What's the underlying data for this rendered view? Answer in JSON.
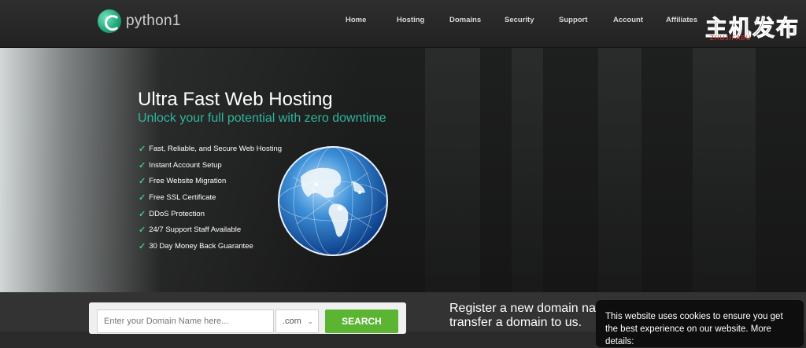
{
  "header": {
    "logo_text": "python1",
    "nav": [
      "Home",
      "Hosting",
      "Domains",
      "Security",
      "Support",
      "Account",
      "Affiliates"
    ],
    "watermark": {
      "main": "主机发布",
      "sub": "ZHUJIFABU"
    }
  },
  "hero": {
    "title": "Ultra Fast Web Hosting",
    "subtitle": "Unlock your full potential with zero downtime",
    "features": [
      "Fast, Reliable, and Secure Web Hosting",
      "Instant Account Setup",
      "Free Website Migration",
      "Free SSL Certificate",
      "DDoS Protection",
      "24/7 Support Staff Available",
      "30 Day Money Back Guarantee"
    ]
  },
  "domain_search": {
    "placeholder": "Enter your Domain Name here...",
    "tld": ".com",
    "button": "SEARCH"
  },
  "register": {
    "line1": "Register a new domain name or",
    "line2": "transfer a domain to us."
  },
  "cookie": {
    "text": "This website uses cookies to ensure you get the best experience on our website. More details:"
  },
  "colors": {
    "accent": "#2fb69b",
    "search_button": "#5bb532"
  }
}
